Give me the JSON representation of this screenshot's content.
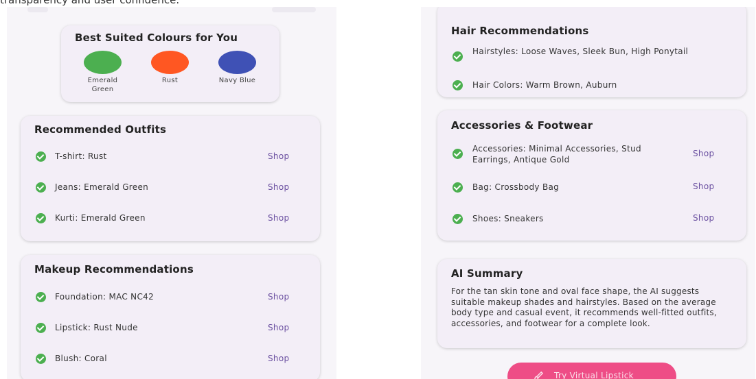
{
  "caption": "transparency and user confidence.",
  "colours": {
    "title": "Best Suited Colours for You",
    "items": [
      {
        "label": "Emerald Green",
        "color": "#4caf50"
      },
      {
        "label": "Rust",
        "color": "#ff5722"
      },
      {
        "label": "Navy Blue",
        "color": "#3f51b5"
      }
    ]
  },
  "outfits": {
    "title": "Recommended Outfits",
    "items": [
      {
        "text": "T-shirt: Rust",
        "action": "Shop"
      },
      {
        "text": "Jeans: Emerald Green",
        "action": "Shop"
      },
      {
        "text": "Kurti: Emerald Green",
        "action": "Shop"
      }
    ]
  },
  "makeup": {
    "title": "Makeup Recommendations",
    "items": [
      {
        "text": "Foundation: MAC NC42",
        "action": "Shop"
      },
      {
        "text": "Lipstick: Rust Nude",
        "action": "Shop"
      },
      {
        "text": "Blush: Coral",
        "action": "Shop"
      }
    ]
  },
  "hair": {
    "title": "Hair Recommendations",
    "items": [
      {
        "text": "Hairstyles: Loose Waves, Sleek Bun, High Ponytail"
      },
      {
        "text": "Hair Colors: Warm Brown, Auburn"
      }
    ]
  },
  "accessories": {
    "title": "Accessories & Footwear",
    "items": [
      {
        "text": "Accessories: Minimal Accessories, Stud Earrings, Antique Gold",
        "action": "Shop"
      },
      {
        "text": "Bag: Crossbody Bag",
        "action": "Shop"
      },
      {
        "text": "Shoes: Sneakers",
        "action": "Shop"
      }
    ]
  },
  "summary": {
    "title": "AI Summary",
    "text": "For the tan skin tone and oval face shape, the AI suggests suitable makeup shades and hairstyles. Based on the average body type and casual event, it recommends well-fitted outfits, accessories, and footwear for a complete look."
  },
  "lipstick_button": {
    "label": "Try Virtual Lipstick",
    "icon": "brush-icon"
  },
  "theme": {
    "check_color": "#4caf50",
    "accent": "#6a4fa0",
    "button_color": "#ee4d86"
  }
}
